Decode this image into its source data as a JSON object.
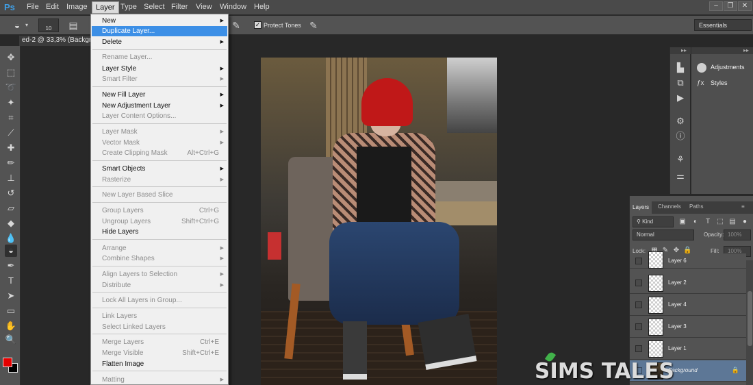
{
  "app": {
    "logo": "Ps"
  },
  "menubar": {
    "items": [
      "File",
      "Edit",
      "Image",
      "Layer",
      "Type",
      "Select",
      "Filter",
      "View",
      "Window",
      "Help"
    ],
    "active": "Layer"
  },
  "window_controls": [
    "–",
    "❐",
    "✕"
  ],
  "options_bar": {
    "brush_size": "10",
    "protect_tones_label": "Protect Tones",
    "protect_tones_checked": true,
    "workspace": "Essentials"
  },
  "document_tab": {
    "title": "ed-2 @ 33,3% (Backgro"
  },
  "layer_menu": {
    "items": [
      {
        "label": "New",
        "submenu": true
      },
      {
        "label": "Duplicate Layer...",
        "highlight": true
      },
      {
        "label": "Delete",
        "submenu": true
      },
      {
        "label": "Rename Layer...",
        "disabled": true
      },
      {
        "label": "Layer Style",
        "submenu": true
      },
      {
        "label": "Smart Filter",
        "disabled": true,
        "submenu": true
      },
      {
        "label": "New Fill Layer",
        "submenu": true
      },
      {
        "label": "New Adjustment Layer",
        "submenu": true
      },
      {
        "label": "Layer Content Options...",
        "disabled": true
      },
      {
        "label": "Layer Mask",
        "disabled": true,
        "submenu": true
      },
      {
        "label": "Vector Mask",
        "disabled": true,
        "submenu": true
      },
      {
        "label": "Create Clipping Mask",
        "disabled": true,
        "shortcut": "Alt+Ctrl+G"
      },
      {
        "label": "Smart Objects",
        "submenu": true
      },
      {
        "label": "Rasterize",
        "disabled": true,
        "submenu": true
      },
      {
        "label": "New Layer Based Slice",
        "disabled": true
      },
      {
        "label": "Group Layers",
        "disabled": true,
        "shortcut": "Ctrl+G"
      },
      {
        "label": "Ungroup Layers",
        "disabled": true,
        "shortcut": "Shift+Ctrl+G"
      },
      {
        "label": "Hide Layers"
      },
      {
        "label": "Arrange",
        "disabled": true,
        "submenu": true
      },
      {
        "label": "Combine Shapes",
        "disabled": true,
        "submenu": true
      },
      {
        "label": "Align Layers to Selection",
        "disabled": true,
        "submenu": true
      },
      {
        "label": "Distribute",
        "disabled": true,
        "submenu": true
      },
      {
        "label": "Lock All Layers in Group...",
        "disabled": true
      },
      {
        "label": "Link Layers",
        "disabled": true
      },
      {
        "label": "Select Linked Layers",
        "disabled": true
      },
      {
        "label": "Merge Layers",
        "disabled": true,
        "shortcut": "Ctrl+E"
      },
      {
        "label": "Merge Visible",
        "disabled": true,
        "shortcut": "Shift+Ctrl+E"
      },
      {
        "label": "Flatten Image"
      },
      {
        "label": "Matting",
        "disabled": true,
        "submenu": true
      }
    ]
  },
  "adjustments_panel": {
    "items": [
      {
        "label": "Adjustments",
        "icon": "adjustments-icon"
      },
      {
        "label": "Styles",
        "icon": "styles-icon"
      }
    ]
  },
  "layers_panel": {
    "tabs": [
      "Layers",
      "Channels",
      "Paths"
    ],
    "active_tab": "Layers",
    "filter_kind": "Kind",
    "blend_mode": "Normal",
    "opacity_label": "Opacity:",
    "opacity_value": "100%",
    "lock_label": "Lock:",
    "fill_label": "Fill:",
    "fill_value": "100%",
    "layers": [
      {
        "name": "Layer 6"
      },
      {
        "name": "Layer 2"
      },
      {
        "name": "Layer 4"
      },
      {
        "name": "Layer 3"
      },
      {
        "name": "Layer 1"
      },
      {
        "name": "Background",
        "selected": true,
        "locked": true
      }
    ]
  },
  "watermark": {
    "text": "SIMS TALES"
  },
  "colors": {
    "foreground": "#e60000",
    "background": "#000000",
    "highlight": "#3c8fe6"
  }
}
